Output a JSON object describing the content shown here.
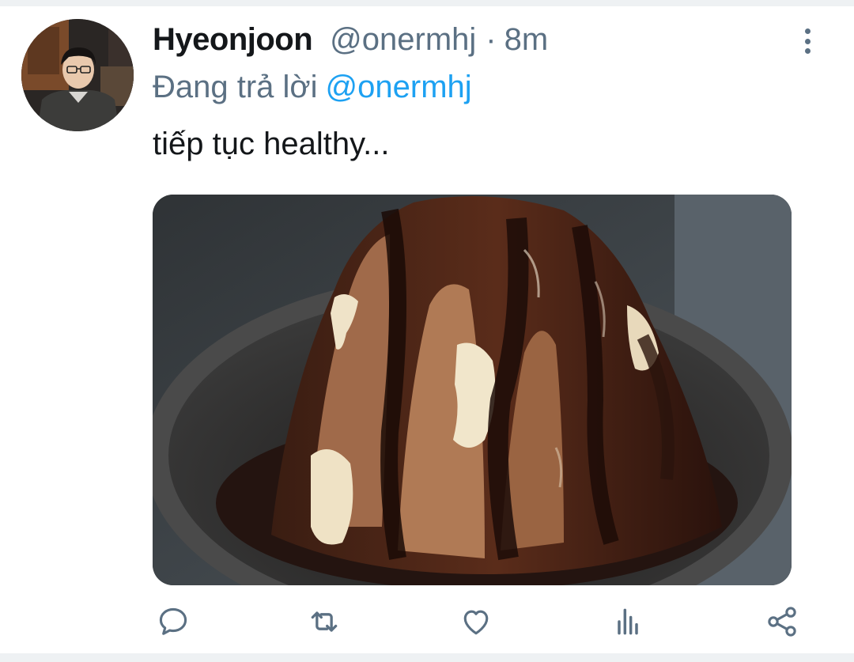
{
  "tweet": {
    "author_name": "Hyeonjoon",
    "author_handle": "@onermhj",
    "separator": "·",
    "timestamp": "8m",
    "reply_prefix": "Đang trả lời",
    "reply_to": "@onermhj",
    "text": "tiếp tục healthy..."
  },
  "icons": {
    "more": "more-vertical-icon",
    "reply": "comment-icon",
    "retweet": "retweet-icon",
    "like": "heart-icon",
    "analytics": "analytics-icon",
    "share": "share-icon"
  },
  "colors": {
    "primary_text": "#14171a",
    "secondary_text": "#5b7083",
    "accent": "#1da1f2",
    "divider": "#eef1f3"
  }
}
